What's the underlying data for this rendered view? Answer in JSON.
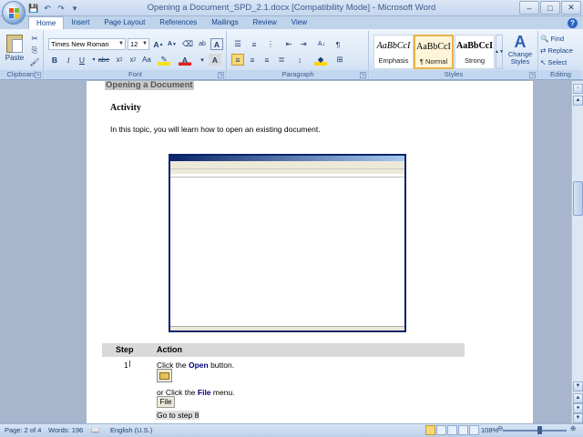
{
  "window": {
    "title": "Opening a Document_SPD_2.1.docx [Compatibility Mode] - Microsoft Word",
    "controls": [
      "–",
      "□",
      "✕"
    ]
  },
  "qat": [
    "save-icon",
    "undo-icon",
    "redo-icon",
    "customize-icon"
  ],
  "tabs": [
    "Home",
    "Insert",
    "Page Layout",
    "References",
    "Mailings",
    "Review",
    "View"
  ],
  "active_tab": "Home",
  "ribbon": {
    "clipboard": {
      "label": "Clipboard",
      "paste": "Paste"
    },
    "font": {
      "label": "Font",
      "name": "Times New Roman",
      "size": "12"
    },
    "paragraph": {
      "label": "Paragraph"
    },
    "styles": {
      "label": "Styles",
      "items": [
        {
          "sample": "AaBbCcI",
          "name": "Emphasis",
          "selected": false
        },
        {
          "sample": "AaBbCcI",
          "name": "¶ Normal",
          "selected": true
        },
        {
          "sample": "AaBbCcI",
          "name": "Strong",
          "selected": false
        }
      ],
      "change_styles": "Change Styles"
    },
    "editing": {
      "label": "Editing",
      "find": "Find",
      "replace": "Replace",
      "select": "Select"
    }
  },
  "document": {
    "heading": "Opening a Document",
    "activity": "Activity",
    "intro": "In this topic, you will learn how to open an existing document.",
    "table": {
      "col_step": "Step",
      "col_action": "Action",
      "step_num": "1",
      "click_the": "Click the ",
      "open_word": "Open",
      "button_word": " button.",
      "or_text": "or",
      "click_the2": " Click the ",
      "file_word": "File",
      "menu_word": " menu.",
      "file_btn": "File",
      "goto": "Go to step 8"
    }
  },
  "statusbar": {
    "page": "Page: 2 of 4",
    "words": "Words: 196",
    "language": "English (U.S.)",
    "zoom": "108%"
  }
}
